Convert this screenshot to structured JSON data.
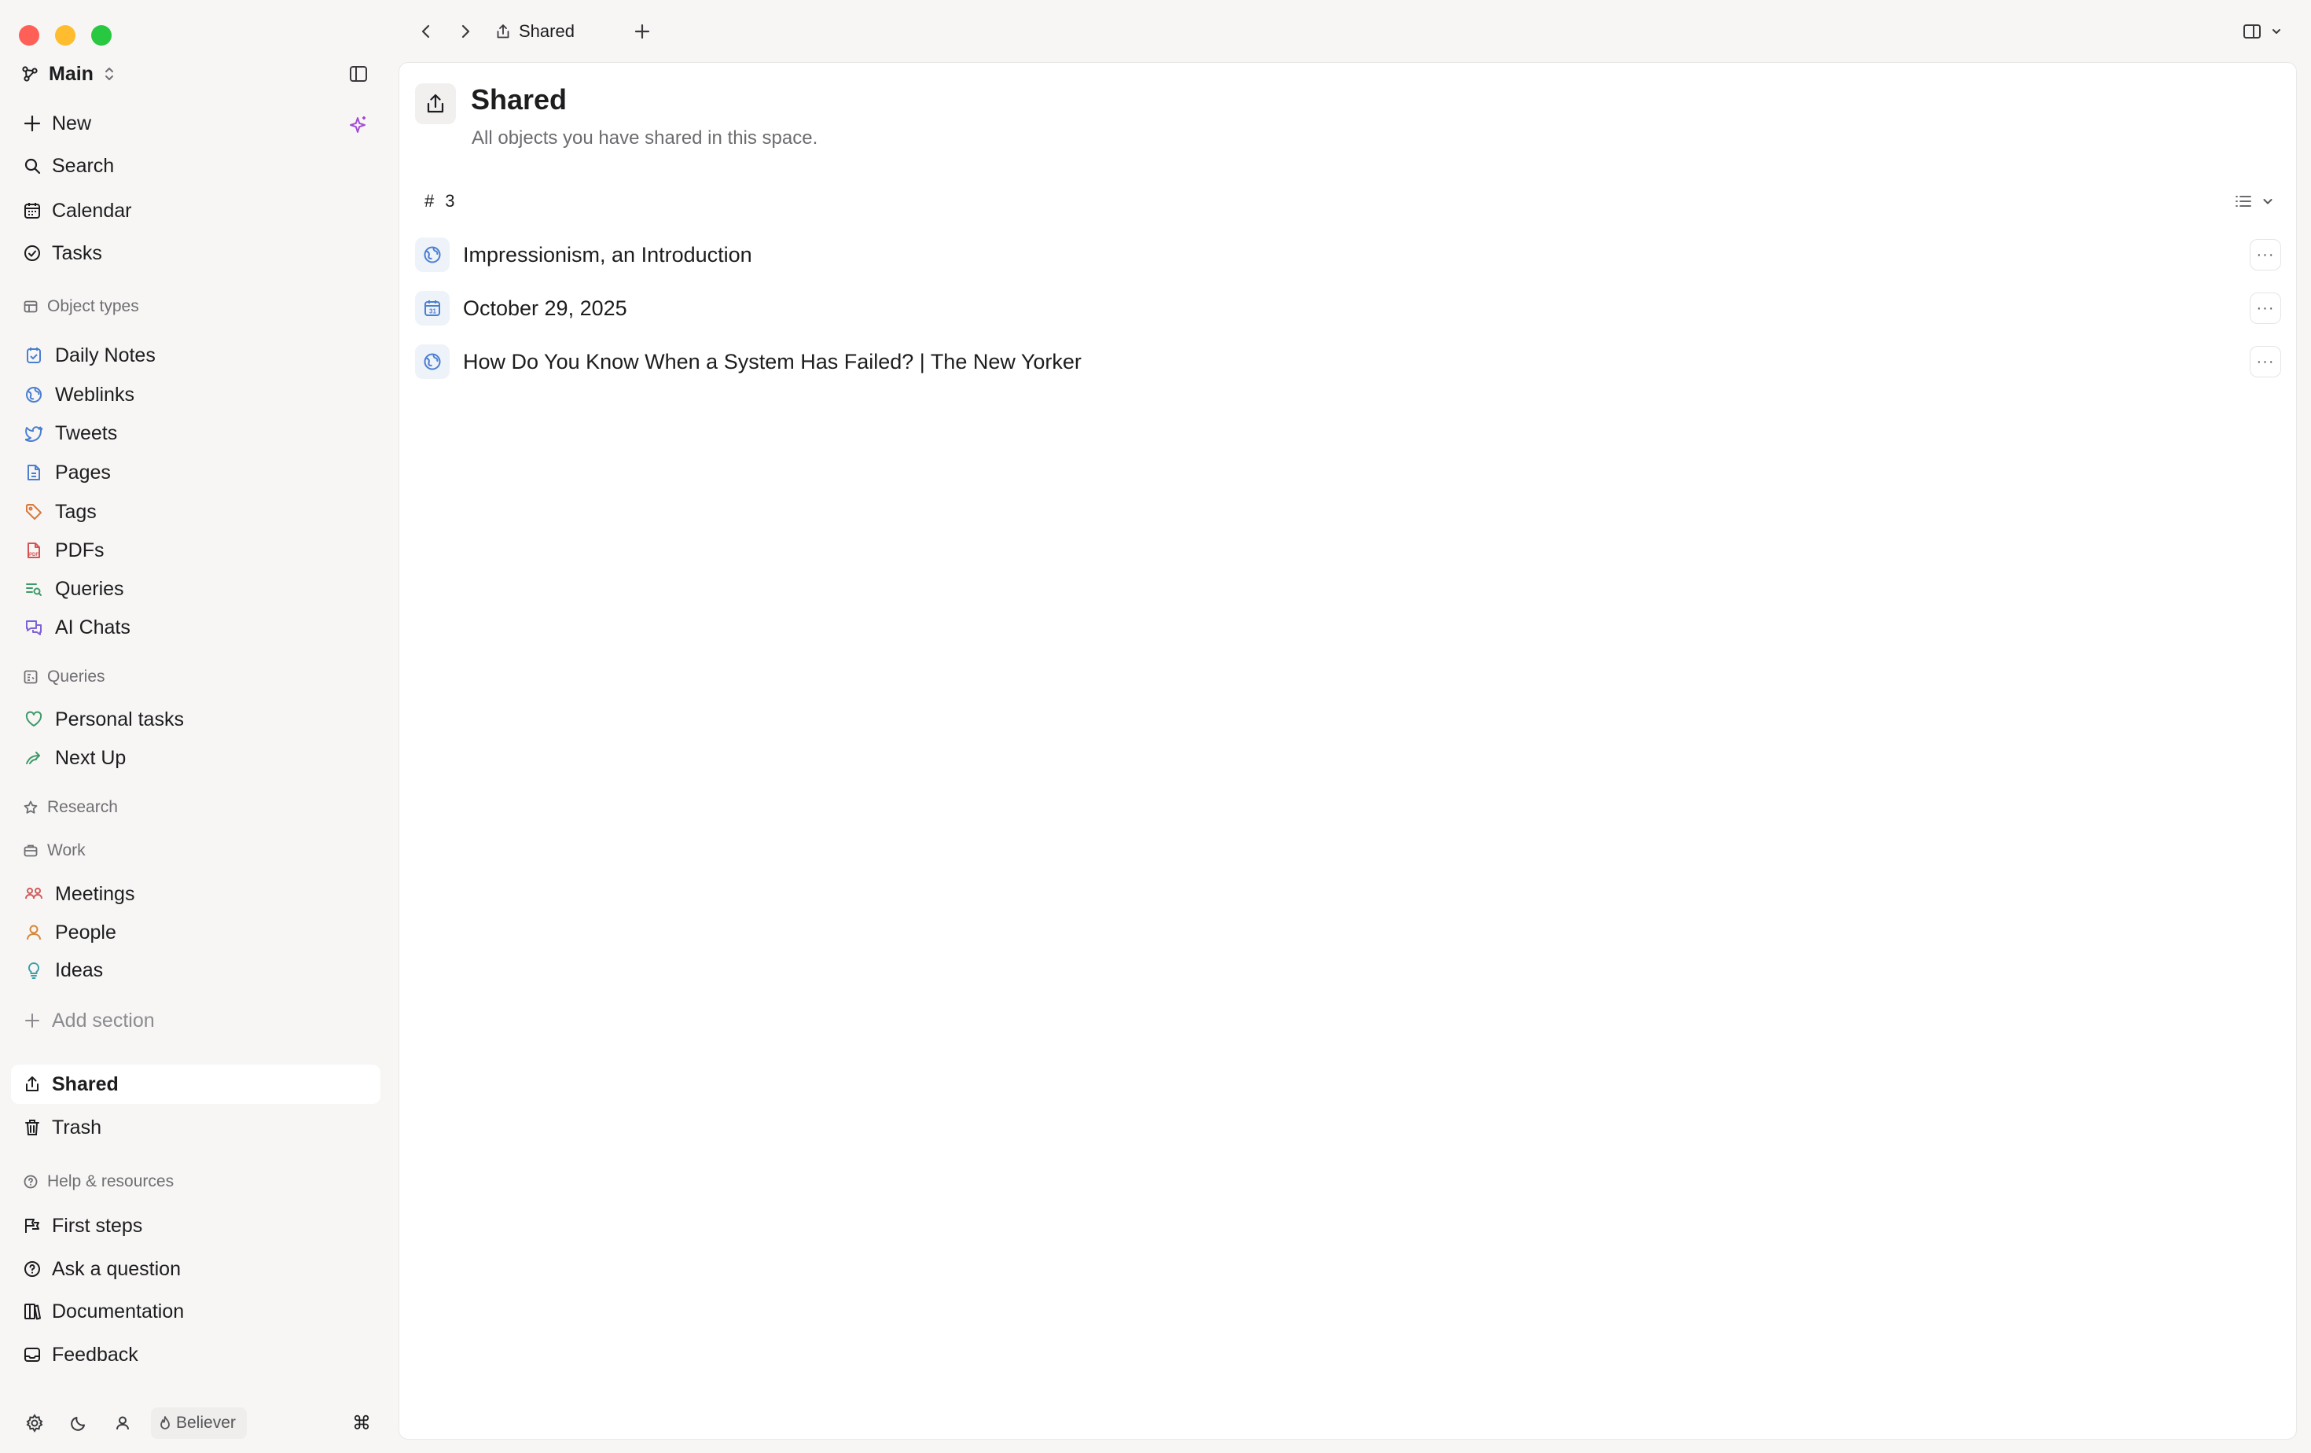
{
  "window": {
    "title": "Shared"
  },
  "sidebar": {
    "space_name": "Main",
    "top_items": [
      {
        "label": "New",
        "icon": "plus-icon"
      },
      {
        "label": "Search",
        "icon": "search-icon"
      },
      {
        "label": "Calendar",
        "icon": "calendar-icon"
      },
      {
        "label": "Tasks",
        "icon": "check-circle-icon"
      }
    ],
    "object_types_heading": "Object types",
    "object_types": [
      {
        "label": "Daily Notes",
        "icon": "daily-note-icon"
      },
      {
        "label": "Weblinks",
        "icon": "globe-icon"
      },
      {
        "label": "Tweets",
        "icon": "bird-icon"
      },
      {
        "label": "Pages",
        "icon": "page-icon"
      },
      {
        "label": "Tags",
        "icon": "tag-icon"
      },
      {
        "label": "PDFs",
        "icon": "pdf-icon"
      },
      {
        "label": "Queries",
        "icon": "query-icon"
      },
      {
        "label": "AI Chats",
        "icon": "chat-icon"
      }
    ],
    "queries_heading": "Queries",
    "queries": [
      {
        "label": "Personal tasks",
        "icon": "heart-icon"
      },
      {
        "label": "Next Up",
        "icon": "trend-arrow-icon"
      }
    ],
    "research_heading": "Research",
    "work_heading": "Work",
    "work_items": [
      {
        "label": "Meetings",
        "icon": "meeting-icon"
      },
      {
        "label": "People",
        "icon": "person-icon"
      },
      {
        "label": "Ideas",
        "icon": "lightbulb-icon"
      }
    ],
    "add_section_label": "Add section",
    "shared_label": "Shared",
    "trash_label": "Trash",
    "help_heading": "Help & resources",
    "help_items": [
      {
        "label": "First steps",
        "icon": "first-steps-icon"
      },
      {
        "label": "Ask a question",
        "icon": "question-icon"
      },
      {
        "label": "Documentation",
        "icon": "book-icon"
      },
      {
        "label": "Feedback",
        "icon": "inbox-icon"
      }
    ],
    "footer": {
      "badge_label": "Believer",
      "command_symbol": "⌘"
    }
  },
  "tabbar": {
    "active_tab_label": "Shared"
  },
  "main": {
    "title": "Shared",
    "description": "All objects you have shared in this space.",
    "count_symbol": "#",
    "count": "3",
    "items": [
      {
        "title": "Impressionism, an Introduction",
        "icon": "globe-icon"
      },
      {
        "title": "October 29, 2025",
        "icon": "calendar-icon"
      },
      {
        "title": "How Do You Know When a System Has Failed? | The New Yorker",
        "icon": "globe-icon"
      }
    ],
    "more_symbol": "···"
  },
  "colors": {
    "accent_purple": "#a24bd8",
    "weblink_blue": "#4a7fd1",
    "tag_orange": "#d9793b",
    "pdf_red": "#d65353",
    "query_green": "#3f9a6a",
    "meeting_red": "#d15a5a",
    "people_orange": "#d4883a",
    "idea_teal": "#3aa0a6"
  }
}
